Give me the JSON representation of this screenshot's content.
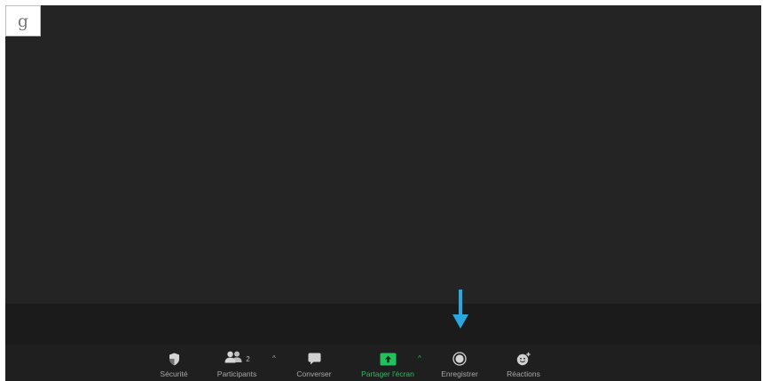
{
  "thumbnail": {
    "letter": "g"
  },
  "toolbar": {
    "security": {
      "label": "Sécurité",
      "icon": "shield-icon"
    },
    "participants": {
      "label": "Participants",
      "count": "2",
      "icon": "people-icon"
    },
    "chat": {
      "label": "Converser",
      "icon": "chat-bubble-icon"
    },
    "share": {
      "label": "Partager l'écran",
      "icon": "share-screen-up-arrow-icon"
    },
    "record": {
      "label": "Enregistrer",
      "icon": "record-circle-icon"
    },
    "reactions": {
      "label": "Réactions",
      "icon": "smiley-plus-icon"
    }
  },
  "colors": {
    "share_green": "#22c15e",
    "annotation_arrow": "#29a8e0",
    "toolbar_bg": "#1f1f1f",
    "video_bg": "#242424"
  }
}
